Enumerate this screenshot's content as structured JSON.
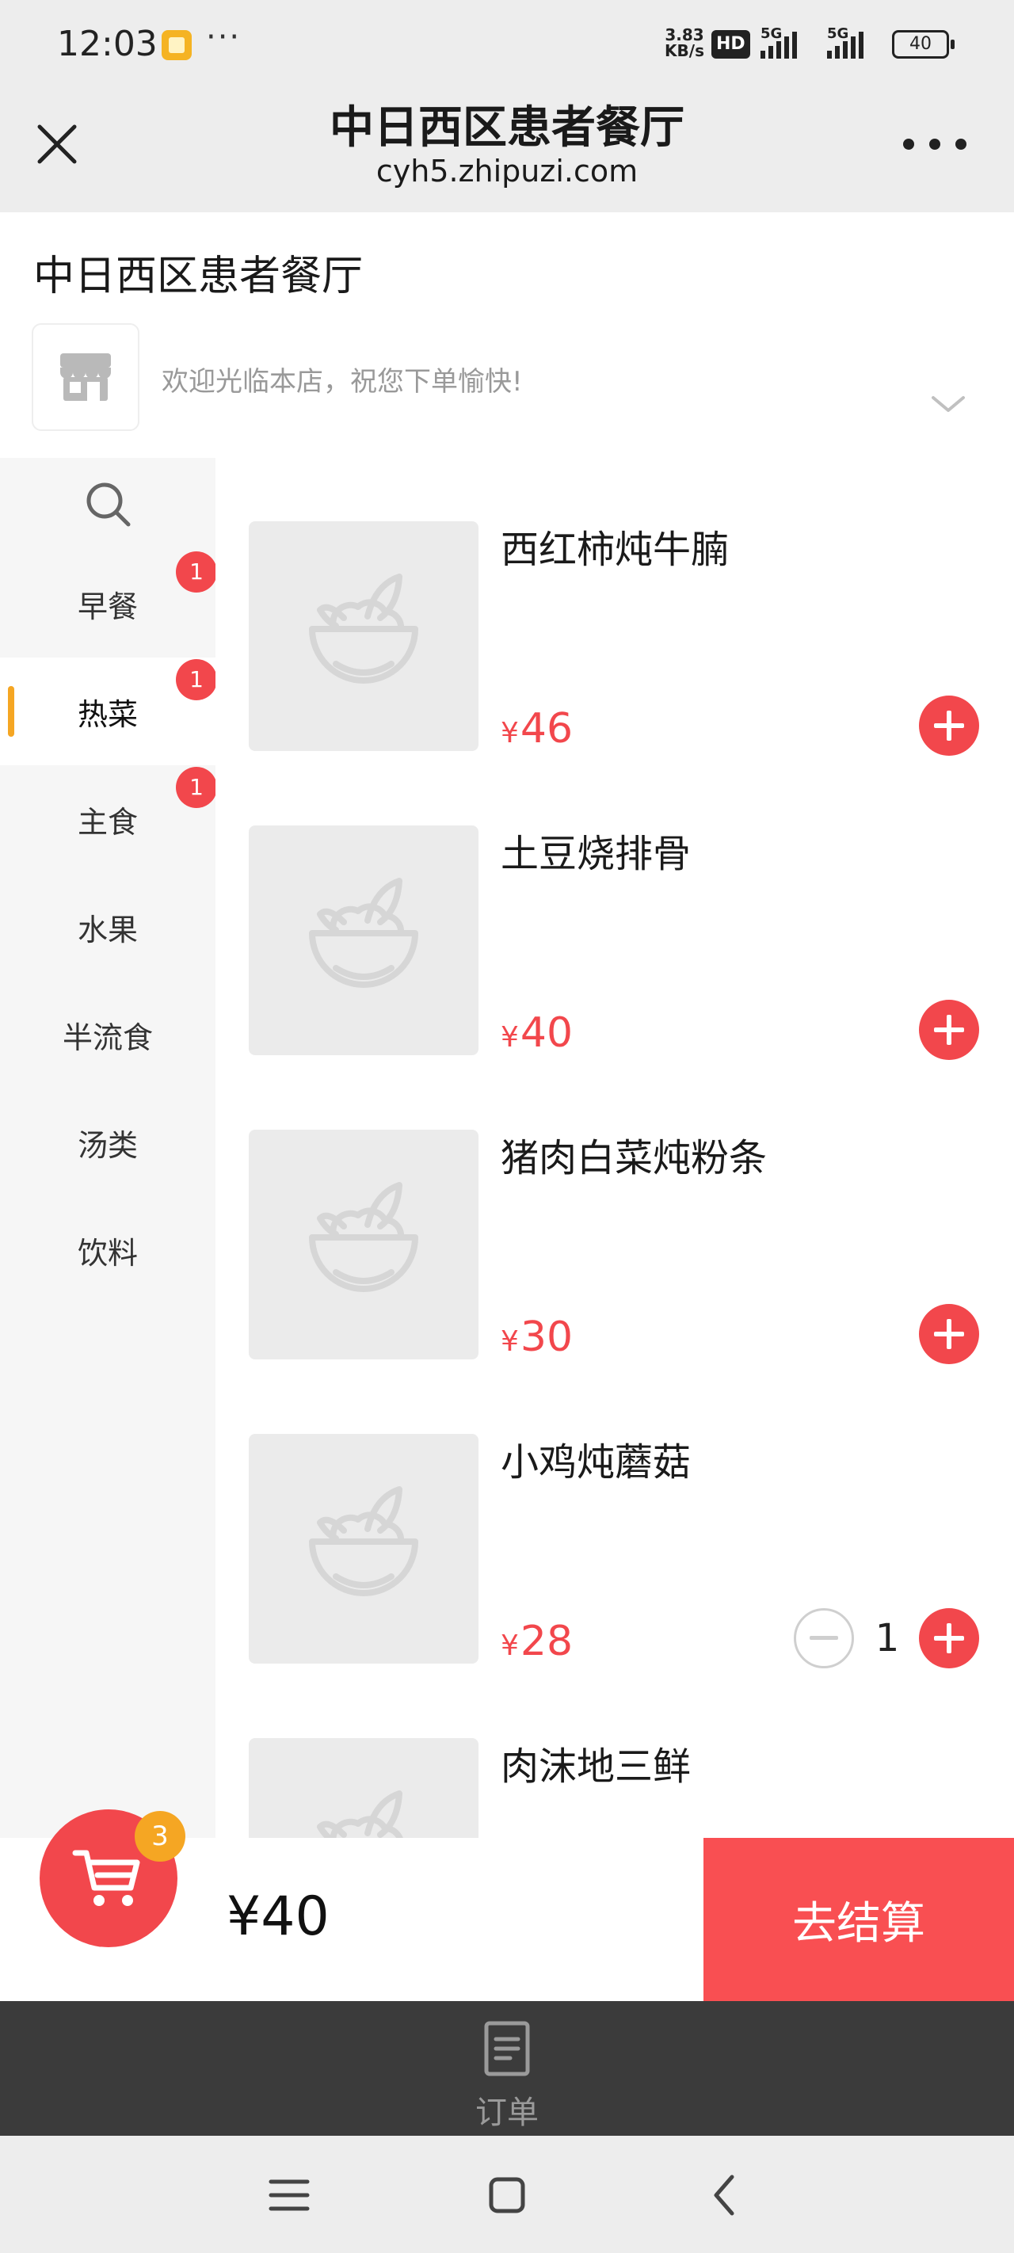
{
  "status_bar": {
    "time": "12:03",
    "net_speed_value": "3.83",
    "net_speed_unit": "KB/s",
    "hd_label": "HD",
    "signal1_label": "5G",
    "signal2_label": "5G",
    "battery": "40"
  },
  "nav": {
    "title": "中日西区患者餐厅",
    "url": "cyh5.zhipuzi.com",
    "close_icon": "close-icon",
    "more_icon": "more-dots-icon"
  },
  "store": {
    "name": "中日西区患者餐厅",
    "notice": "欢迎光临本店，祝您下单愉快!",
    "logo_icon": "storefront-icon",
    "expand_icon": "chevron-down-icon"
  },
  "sidebar": {
    "search_icon": "search-icon",
    "categories": [
      {
        "label": "早餐",
        "badge": "1",
        "active": false
      },
      {
        "label": "热菜",
        "badge": "1",
        "active": true
      },
      {
        "label": "主食",
        "badge": "1",
        "active": false
      },
      {
        "label": "水果",
        "badge": "",
        "active": false
      },
      {
        "label": "半流食",
        "badge": "",
        "active": false
      },
      {
        "label": "汤类",
        "badge": "",
        "active": false
      },
      {
        "label": "饮料",
        "badge": "",
        "active": false
      }
    ]
  },
  "products": [
    {
      "name": "西红柿炖牛腩",
      "currency": "¥",
      "price": "46",
      "quantity": 0
    },
    {
      "name": "土豆烧排骨",
      "currency": "¥",
      "price": "40",
      "quantity": 0
    },
    {
      "name": "猪肉白菜炖粉条",
      "currency": "¥",
      "price": "30",
      "quantity": 0
    },
    {
      "name": "小鸡炖蘑菇",
      "currency": "¥",
      "price": "28",
      "quantity": "1"
    },
    {
      "name": "肉沫地三鲜",
      "currency": "¥",
      "price": "",
      "quantity": 0
    }
  ],
  "cart": {
    "count": "3",
    "total": "¥40",
    "checkout_label": "去结算",
    "cart_icon": "shopping-cart-icon"
  },
  "tabbar": {
    "orders_label": "订单",
    "orders_icon": "document-icon"
  },
  "system_nav": {
    "menu_icon": "menu-lines-icon",
    "home_icon": "square-home-icon",
    "back_icon": "back-chevron-icon"
  },
  "colors": {
    "accent_red": "#f2474c",
    "checkout_red": "#f94f52",
    "badge_orange": "#f5a623",
    "tabbar_dark": "#3b3b3b"
  }
}
